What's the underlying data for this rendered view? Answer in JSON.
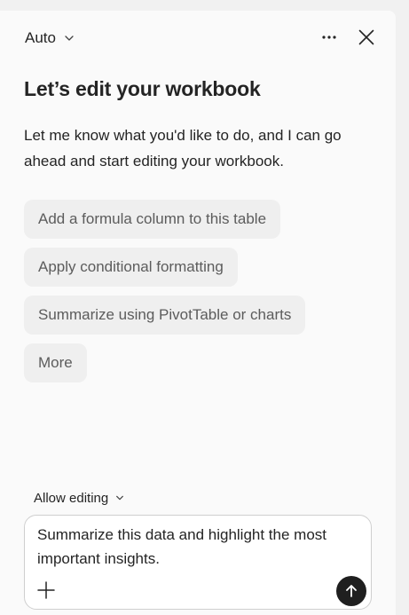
{
  "header": {
    "mode_label": "Auto",
    "more_icon": "more-horizontal-icon",
    "close_icon": "close-icon"
  },
  "main": {
    "heading": "Let’s edit your workbook",
    "intro": "Let me know what you'd like to do, and I can go ahead and start editing your workbook.",
    "suggestions": [
      "Add a formula column to this table",
      "Apply conditional formatting",
      "Summarize using PivotTable or charts",
      "More"
    ]
  },
  "composer": {
    "permission_label": "Allow editing",
    "input_value": "Summarize this data and highlight the most important insights.",
    "add_icon": "plus-icon",
    "send_icon": "arrow-up-icon"
  },
  "colors": {
    "background": "#fafafa",
    "chip_background": "#efefef",
    "chip_text": "#5c5c5c",
    "send_button": "#1f1f1f"
  }
}
